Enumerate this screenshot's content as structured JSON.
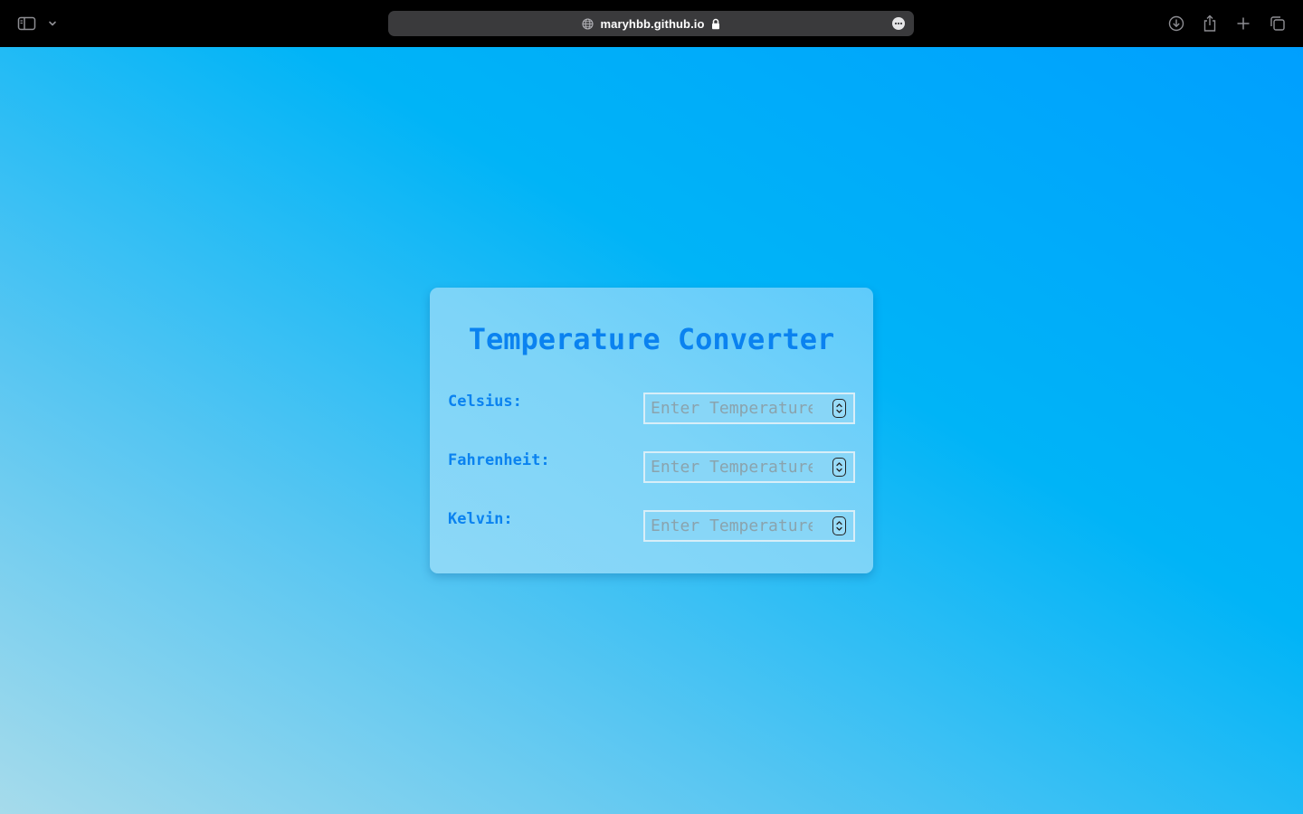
{
  "browser": {
    "url": "maryhbb.github.io",
    "icons": {
      "sidebar": "sidebar-icon",
      "sidebar_menu": "chevron-down-icon",
      "site": "globe-icon",
      "secure": "lock-icon",
      "page_menu": "more-icon",
      "downloads": "download-icon",
      "share": "share-icon",
      "new_tab": "plus-icon",
      "tabs_overview": "tabs-overview-icon"
    }
  },
  "app": {
    "title": "Temperature Converter",
    "fields": [
      {
        "label": "Celsius:",
        "placeholder": "Enter Temperature"
      },
      {
        "label": "Fahrenheit:",
        "placeholder": "Enter Temperature"
      },
      {
        "label": "Kelvin:",
        "placeholder": "Enter Temperature"
      }
    ]
  },
  "colors": {
    "accent": "#0a82f0",
    "toolbar": "#000000",
    "address_bar": "#3a3a3c"
  }
}
